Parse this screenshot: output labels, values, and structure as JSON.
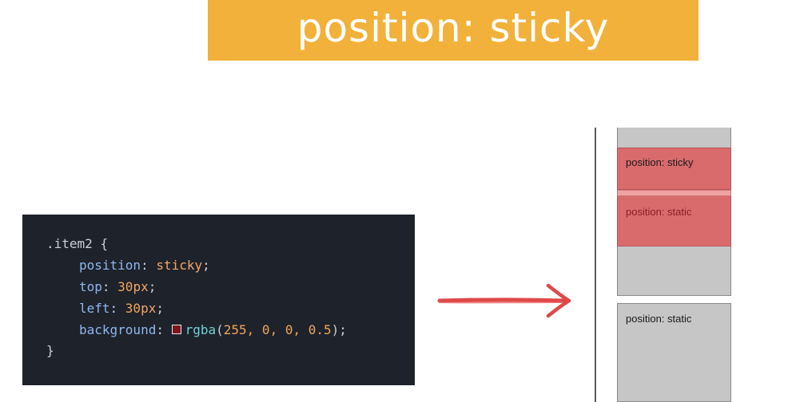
{
  "title": "position: sticky",
  "colors": {
    "banner": "#f2b13a",
    "code_bg": "#1e222a",
    "arrow": "#e04848",
    "sticky_box": "#d96b6d",
    "static_box": "#c6c6c6"
  },
  "code": {
    "selector": ".item2",
    "open_brace": "{",
    "close_brace": "}",
    "lines": [
      {
        "prop": "position",
        "value": "sticky"
      },
      {
        "prop": "top",
        "num": "30",
        "unit": "px"
      },
      {
        "prop": "left",
        "num": "30",
        "unit": "px"
      },
      {
        "prop": "background",
        "fn": "rgba",
        "args": "255, 0, 0, 0.5"
      }
    ],
    "swatch_color": "#7d1420"
  },
  "demo": {
    "sticky_label": "position: sticky",
    "static_label_1": "position: static",
    "static_label_2": "position: static"
  }
}
